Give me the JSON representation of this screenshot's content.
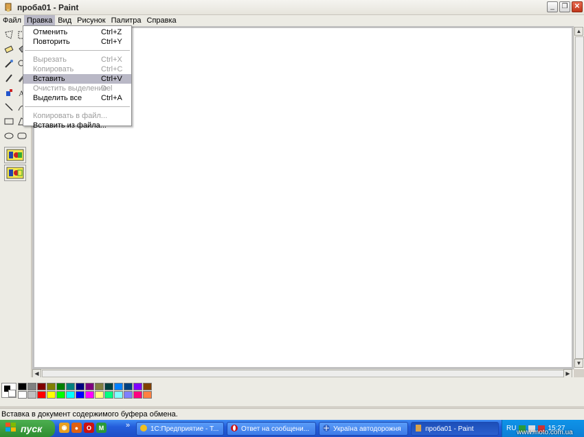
{
  "window": {
    "title": "проба01 - Paint",
    "minimize_glyph": "_",
    "restore_glyph": "❐",
    "close_glyph": "✕"
  },
  "menubar": {
    "items": [
      "Файл",
      "Правка",
      "Вид",
      "Рисунок",
      "Палитра",
      "Справка"
    ],
    "open_index": 1
  },
  "edit_menu": {
    "items": [
      {
        "label": "Отменить",
        "shortcut": "Ctrl+Z",
        "enabled": true
      },
      {
        "label": "Повторить",
        "shortcut": "Ctrl+Y",
        "enabled": true
      },
      {
        "label": "Вырезать",
        "shortcut": "Ctrl+X",
        "enabled": false
      },
      {
        "label": "Копировать",
        "shortcut": "Ctrl+C",
        "enabled": false
      },
      {
        "label": "Вставить",
        "shortcut": "Ctrl+V",
        "enabled": true,
        "selected": true
      },
      {
        "label": "Очистить выделение",
        "shortcut": "Del",
        "enabled": false
      },
      {
        "label": "Выделить все",
        "shortcut": "Ctrl+A",
        "enabled": true
      },
      {
        "label": "Копировать в файл...",
        "shortcut": "",
        "enabled": false
      },
      {
        "label": "Вставить из файла...",
        "shortcut": "",
        "enabled": true
      }
    ]
  },
  "palette": {
    "colors": [
      "#000000",
      "#808080",
      "#800000",
      "#808000",
      "#008000",
      "#008080",
      "#000080",
      "#800080",
      "#808040",
      "#004040",
      "#0080ff",
      "#004080",
      "#8000ff",
      "#804000",
      "#ffffff",
      "#c0c0c0",
      "#ff0000",
      "#ffff00",
      "#00ff00",
      "#00ffff",
      "#0000ff",
      "#ff00ff",
      "#ffff80",
      "#00ff80",
      "#80ffff",
      "#8080ff",
      "#ff0080",
      "#ff8040"
    ]
  },
  "statusbar": {
    "text": "Вставка в документ содержимого буфера обмена."
  },
  "taskbar": {
    "start_label": "пуск",
    "chevron": "»",
    "tasks": [
      {
        "label": "1С:Предприятие - Т..."
      },
      {
        "label": "Ответ на сообщени..."
      },
      {
        "label": "Україна автодорожня"
      },
      {
        "label": "проба01 - Paint"
      }
    ],
    "tray": {
      "lang": "RU",
      "time": "15:27"
    }
  },
  "watermark": "www.moto.com.ua"
}
